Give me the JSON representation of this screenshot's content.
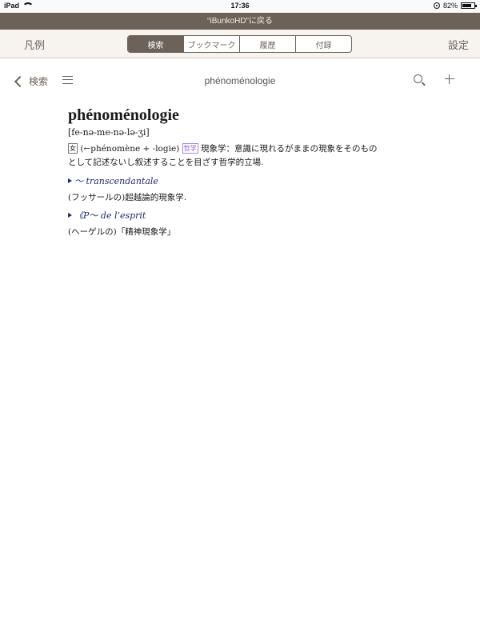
{
  "status_bar": {
    "device": "iPad",
    "time": "17:36",
    "battery": "82%",
    "battery_level": 0.82
  },
  "banner": {
    "return_text": "“iBunkoHD”に戻る"
  },
  "top_bar": {
    "left_label": "凡例",
    "right_label": "設定",
    "segments": [
      "検索",
      "ブックマーク",
      "履歴",
      "付録"
    ],
    "active_segment": "検索"
  },
  "sub_nav": {
    "back_label": "検索",
    "title": "phénoménologie"
  },
  "entry": {
    "headword": "phénoménologie",
    "pronunciation": "[fe-nə-me-nə-lə-ʒi]",
    "pos": "女",
    "etymology": "(←phénomène + -logie)",
    "field": "哲学",
    "definition_1": "現象学：意識に現れるがままの現象をそのもの",
    "definition_2": "として記述ないし叙述することを目ざす哲学的立場.",
    "subentries": [
      {
        "head": "～ transcendantale",
        "definition": "(フッサールの)超越論的現象学."
      },
      {
        "head": "《P～ de l’esprit",
        "definition": "(ヘーゲルの)「精神現象学」"
      }
    ]
  }
}
